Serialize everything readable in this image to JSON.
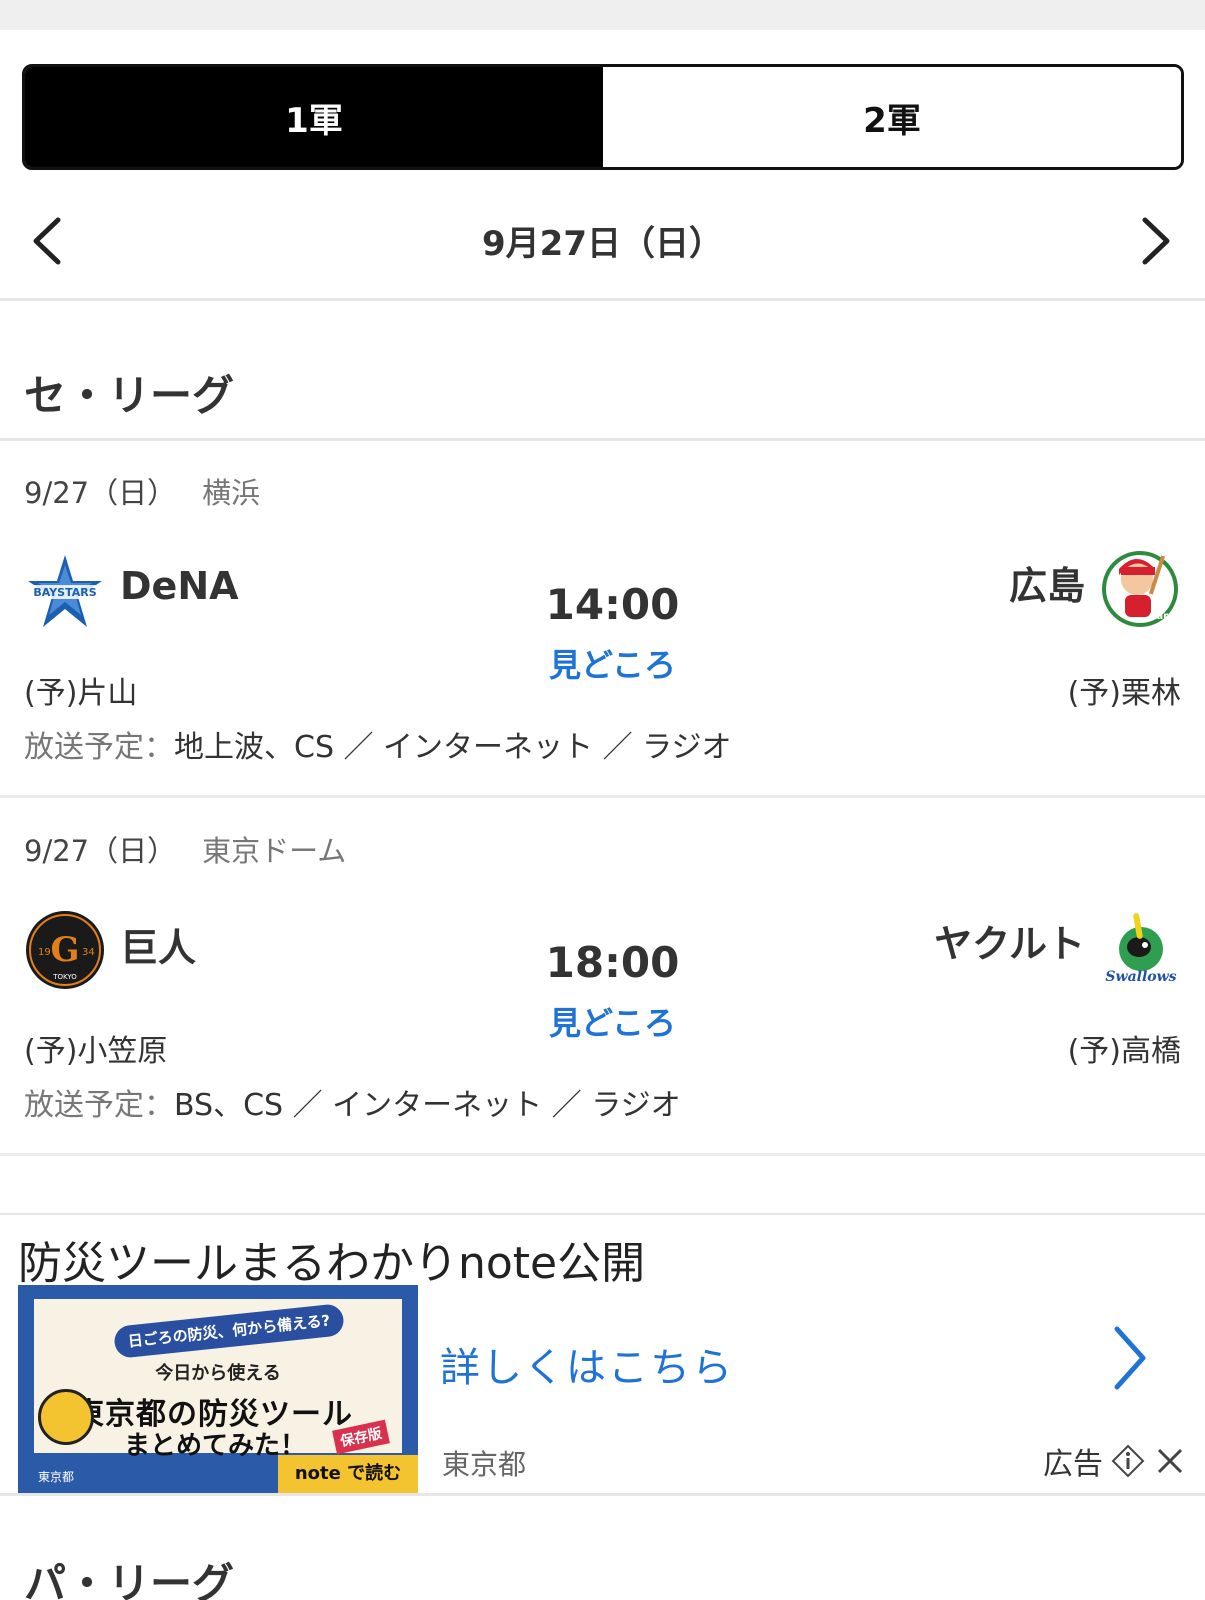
{
  "tabs": [
    {
      "label": "1軍",
      "active": true
    },
    {
      "label": "2軍",
      "active": false
    }
  ],
  "date_nav": {
    "date": "9月27日（日）",
    "prev_icon": "chevron-left-icon",
    "next_icon": "chevron-right-icon"
  },
  "central_league": {
    "title": "セ・リーグ"
  },
  "pacific_league": {
    "title": "パ・リーグ"
  },
  "games": [
    {
      "date": "9/27（日）",
      "venue": "横浜",
      "home": {
        "name": "DeNA",
        "pitcher": "(予)片山",
        "logo": "baystars-logo"
      },
      "away": {
        "name": "広島",
        "pitcher": "(予)栗林",
        "logo": "carp-logo"
      },
      "time": "14:00",
      "highlight_link": "見どころ",
      "broadcast_label": "放送予定：",
      "broadcast": "地上波、CS ／ インターネット ／ ラジオ"
    },
    {
      "date": "9/27（日）",
      "venue": "東京ドーム",
      "home": {
        "name": "巨人",
        "pitcher": "(予)小笠原",
        "logo": "giants-logo"
      },
      "away": {
        "name": "ヤクルト",
        "pitcher": "(予)高橋",
        "logo": "swallows-logo"
      },
      "time": "18:00",
      "highlight_link": "見どころ",
      "broadcast_label": "放送予定：",
      "broadcast": "BS、CS ／ インターネット ／ ラジオ"
    }
  ],
  "ad": {
    "title": "防災ツールまるわかりnote公開",
    "image_text": {
      "pill": "日ごろの防災、何から備える?",
      "line1": "今日から使える",
      "line2": "東京都の防災ツール",
      "line3": "まとめてみた！",
      "stamp": "保存版",
      "note": "note で読む",
      "org_small": "東京都"
    },
    "link": "詳しくはこちら",
    "org": "東京都",
    "label": "広告"
  },
  "colors": {
    "accent": "#1f73d6",
    "tab_active_bg": "#000000"
  }
}
